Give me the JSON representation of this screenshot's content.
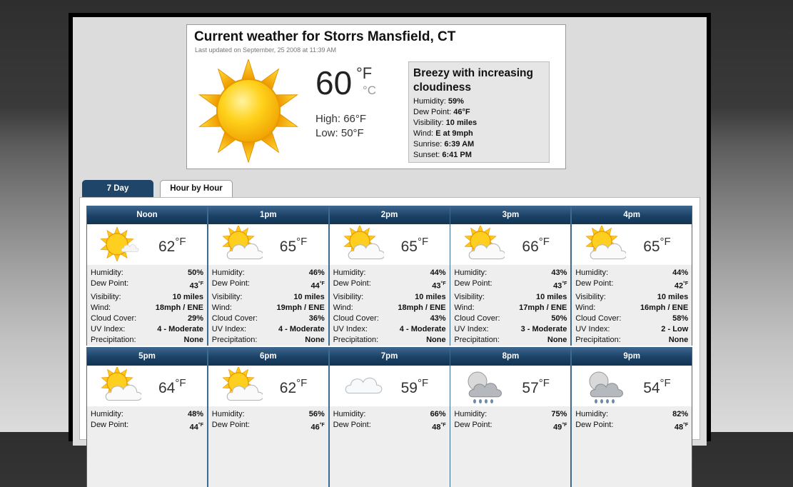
{
  "current": {
    "title": "Current weather for Storrs Mansfield, CT",
    "updated": "Last updated on September, 25 2008 at 11:39 AM",
    "temp": "60",
    "unit_f": "°F",
    "unit_c": "°C",
    "high_label": "High:",
    "high": "66°F",
    "low_label": "Low:",
    "low": "50°F",
    "condition": "Breezy with increasing cloudiness",
    "details": [
      {
        "label": "Humidity:",
        "value": "59%"
      },
      {
        "label": "Dew Point:",
        "value": "46°F"
      },
      {
        "label": "Visibility:",
        "value": "10 miles"
      },
      {
        "label": "Wind:",
        "value": "E at 9mph"
      },
      {
        "label": "Sunrise:",
        "value": "6:39 AM"
      },
      {
        "label": "Sunset:",
        "value": "6:41 PM"
      }
    ],
    "icon": "sun-icon"
  },
  "tabs": [
    {
      "label": "7 Day",
      "active": true
    },
    {
      "label": "Hour by Hour",
      "active": false
    }
  ],
  "detail_labels": [
    "Humidity:",
    "Dew Point:",
    "Visibility:",
    "Wind:",
    "Cloud Cover:",
    "UV Index:",
    "Precipitation:"
  ],
  "hours": [
    {
      "time": "Noon",
      "temp": "62",
      "icon": "sun-icon",
      "humidity": "50%",
      "dew": "43",
      "visibility": "10 miles",
      "wind": "18mph / ENE",
      "cloud": "29%",
      "uv": "4 - Moderate",
      "precip": "None"
    },
    {
      "time": "1pm",
      "temp": "65",
      "icon": "partly-cloudy-icon",
      "humidity": "46%",
      "dew": "44",
      "visibility": "10 miles",
      "wind": "19mph / ENE",
      "cloud": "36%",
      "uv": "4 - Moderate",
      "precip": "None"
    },
    {
      "time": "2pm",
      "temp": "65",
      "icon": "partly-cloudy-icon",
      "humidity": "44%",
      "dew": "43",
      "visibility": "10 miles",
      "wind": "18mph / ENE",
      "cloud": "43%",
      "uv": "4 - Moderate",
      "precip": "None"
    },
    {
      "time": "3pm",
      "temp": "66",
      "icon": "partly-cloudy-icon",
      "humidity": "43%",
      "dew": "43",
      "visibility": "10 miles",
      "wind": "17mph / ENE",
      "cloud": "50%",
      "uv": "3 - Moderate",
      "precip": "None"
    },
    {
      "time": "4pm",
      "temp": "65",
      "icon": "partly-cloudy-icon",
      "humidity": "44%",
      "dew": "42",
      "visibility": "10 miles",
      "wind": "16mph / ENE",
      "cloud": "58%",
      "uv": "2 - Low",
      "precip": "None"
    },
    {
      "time": "5pm",
      "temp": "64",
      "icon": "partly-cloudy-icon",
      "humidity": "48%",
      "dew": "44",
      "visibility": "",
      "wind": "",
      "cloud": "",
      "uv": "",
      "precip": ""
    },
    {
      "time": "6pm",
      "temp": "62",
      "icon": "partly-cloudy-icon",
      "humidity": "56%",
      "dew": "46",
      "visibility": "",
      "wind": "",
      "cloud": "",
      "uv": "",
      "precip": ""
    },
    {
      "time": "7pm",
      "temp": "59",
      "icon": "cloud-icon",
      "humidity": "66%",
      "dew": "48",
      "visibility": "",
      "wind": "",
      "cloud": "",
      "uv": "",
      "precip": ""
    },
    {
      "time": "8pm",
      "temp": "57",
      "icon": "night-rain-icon",
      "humidity": "75%",
      "dew": "49",
      "visibility": "",
      "wind": "",
      "cloud": "",
      "uv": "",
      "precip": ""
    },
    {
      "time": "9pm",
      "temp": "54",
      "icon": "night-rain-icon",
      "humidity": "82%",
      "dew": "48",
      "visibility": "",
      "wind": "",
      "cloud": "",
      "uv": "",
      "precip": ""
    }
  ],
  "deg_unit": "°F",
  "colors": {
    "header": "#1b4166",
    "tab_active": "#1f4668",
    "sun": "#f5b400"
  }
}
